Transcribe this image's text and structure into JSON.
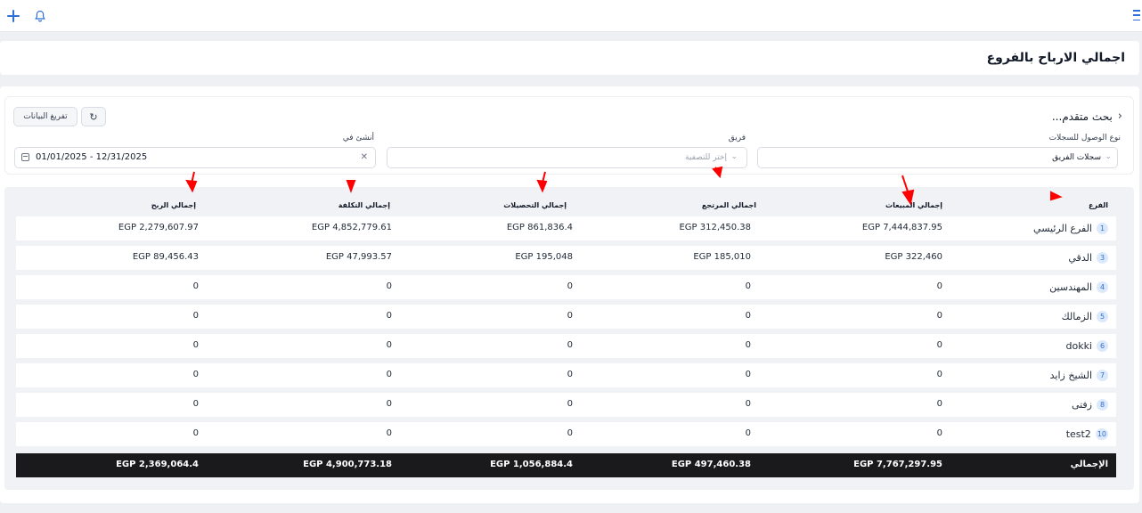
{
  "topbar": {
    "add_icon": "plus-icon",
    "bell_icon": "bell-icon",
    "menu_icon": "menu-icon"
  },
  "page": {
    "title": "اجمالي الارباح بالفروع"
  },
  "search": {
    "advanced_label": "بحث متقدم...",
    "clear_label": "تفريغ البيانات",
    "refresh_icon": "refresh-icon",
    "access_label": "نوع الوصول للسجلات",
    "access_value": "سجلات الفريق",
    "team_label": "فريق",
    "team_placeholder": "إختر للتصفية",
    "created_label": "أنشئ في",
    "created_value": "01/01/2025 - 12/31/2025"
  },
  "table": {
    "headers": {
      "branch": "الفرع",
      "sales": "إجمالي المبيعات",
      "returns": "اجمالي المرتجع",
      "collections": "إجمالي التحصيلات",
      "cost": "إجمالي التكلفة",
      "profit": "إجمالي الربح"
    },
    "rows": [
      {
        "num": "1",
        "branch": "الفرع الرئيسي",
        "sales": "EGP 7,444,837.95",
        "returns": "EGP 312,450.38",
        "collections": "EGP 861,836.4",
        "cost": "EGP 4,852,779.61",
        "profit": "EGP 2,279,607.97"
      },
      {
        "num": "3",
        "branch": "الدقي",
        "sales": "EGP 322,460",
        "returns": "EGP 185,010",
        "collections": "EGP 195,048",
        "cost": "EGP 47,993.57",
        "profit": "EGP 89,456.43"
      },
      {
        "num": "4",
        "branch": "المهندسين",
        "sales": "0",
        "returns": "0",
        "collections": "0",
        "cost": "0",
        "profit": "0"
      },
      {
        "num": "5",
        "branch": "الزمالك",
        "sales": "0",
        "returns": "0",
        "collections": "0",
        "cost": "0",
        "profit": "0"
      },
      {
        "num": "6",
        "branch": "dokki",
        "sales": "0",
        "returns": "0",
        "collections": "0",
        "cost": "0",
        "profit": "0"
      },
      {
        "num": "7",
        "branch": "الشيخ زايد",
        "sales": "0",
        "returns": "0",
        "collections": "0",
        "cost": "0",
        "profit": "0"
      },
      {
        "num": "8",
        "branch": "زفتى",
        "sales": "0",
        "returns": "0",
        "collections": "0",
        "cost": "0",
        "profit": "0"
      },
      {
        "num": "10",
        "branch": "test2",
        "sales": "0",
        "returns": "0",
        "collections": "0",
        "cost": "0",
        "profit": "0"
      }
    ],
    "total": {
      "label": "الإجمالي",
      "sales": "EGP 7,767,297.95",
      "returns": "EGP 497,460.38",
      "collections": "EGP 1,056,884.4",
      "cost": "EGP 4,900,773.18",
      "profit": "EGP 2,369,064.4"
    }
  },
  "colors": {
    "accent": "#2f6fd6",
    "total_row": "#1a1a1c",
    "annotation_arrow": "#ff0000"
  }
}
